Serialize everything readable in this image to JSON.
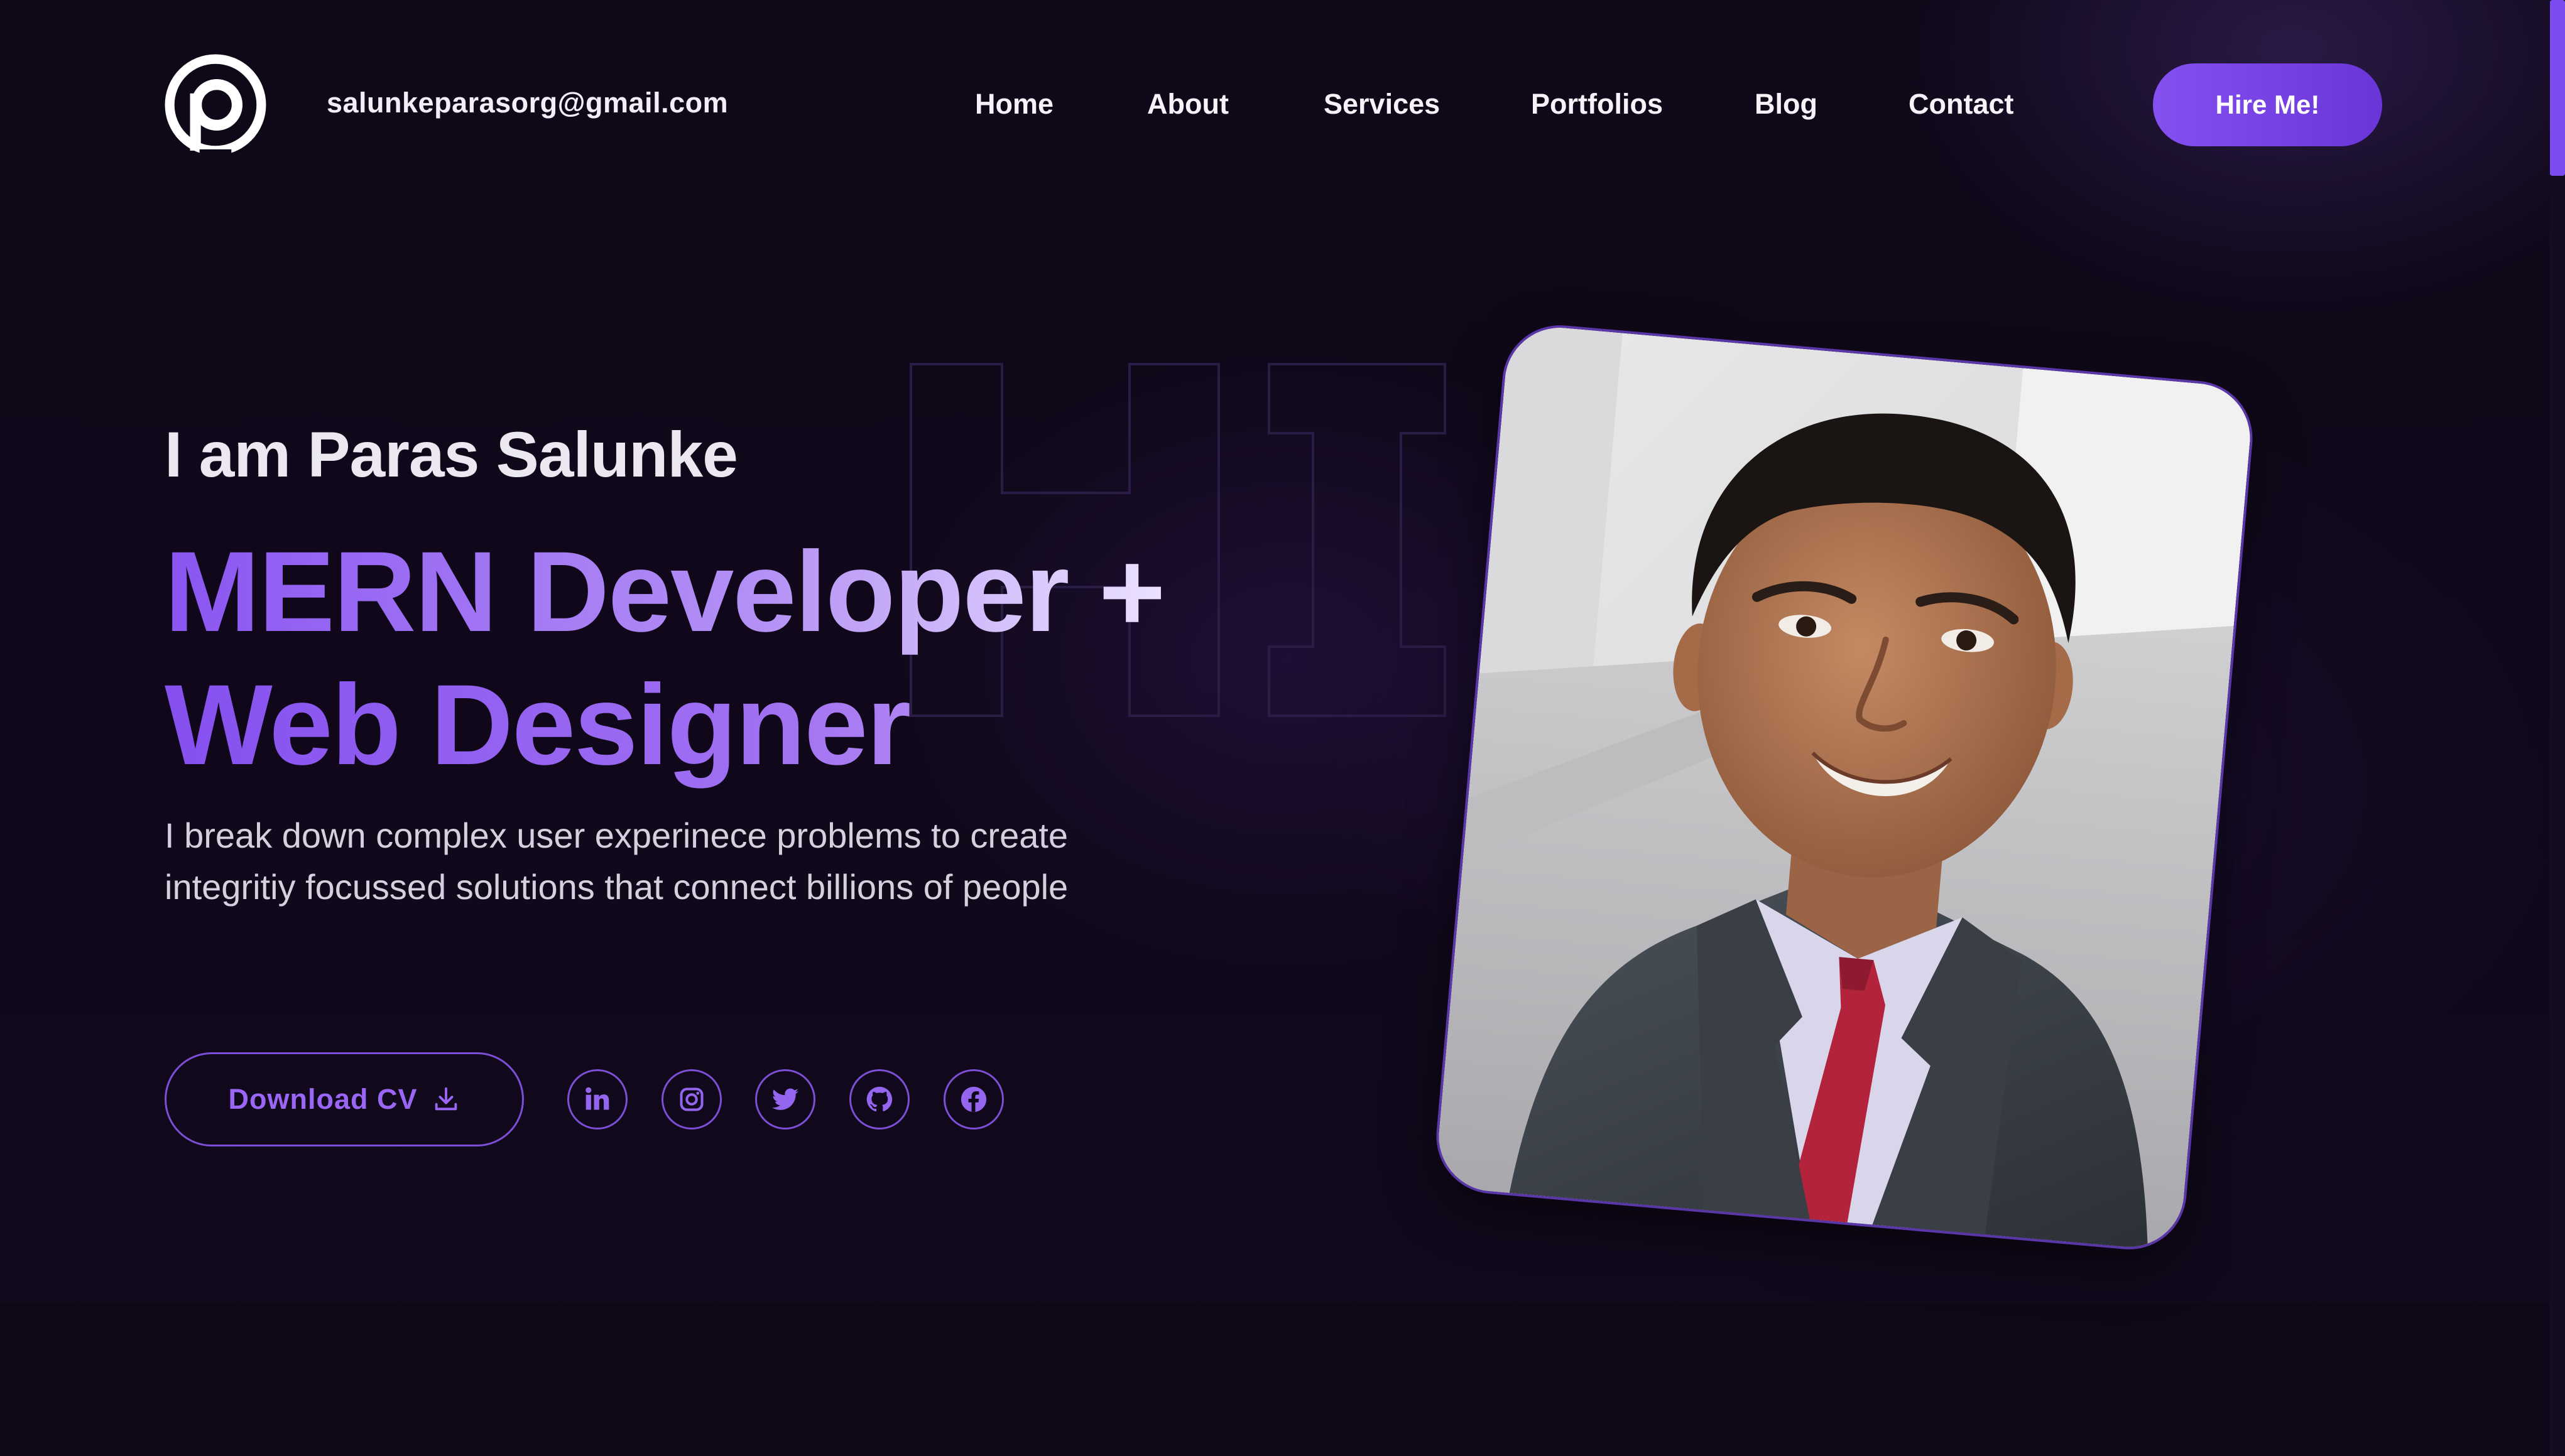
{
  "header": {
    "logo_name": "p-logo",
    "email": "salunkeparasorg@gmail.com",
    "nav": [
      {
        "label": "Home"
      },
      {
        "label": "About"
      },
      {
        "label": "Services"
      },
      {
        "label": "Portfolios"
      },
      {
        "label": "Blog"
      },
      {
        "label": "Contact"
      }
    ],
    "hire_label": "Hire Me!"
  },
  "hero": {
    "intro": "I am Paras Salunke",
    "headline_line1": "MERN Developer +",
    "headline_line2": "Web Designer",
    "description": "I break down complex user experinece problems to create integritiy focussed solutions that connect billions of people",
    "cv_label": "Download CV",
    "cv_icon": "download-icon",
    "socials": [
      {
        "name": "linkedin-icon"
      },
      {
        "name": "instagram-icon"
      },
      {
        "name": "twitter-icon"
      },
      {
        "name": "github-icon"
      },
      {
        "name": "facebook-icon"
      }
    ],
    "photo": "portrait-photo"
  },
  "colors": {
    "background": "#0f0818",
    "accent": "#8550f0",
    "accent_light": "#b491f5",
    "text": "#f2eef8",
    "muted_text": "#d6d0de"
  }
}
